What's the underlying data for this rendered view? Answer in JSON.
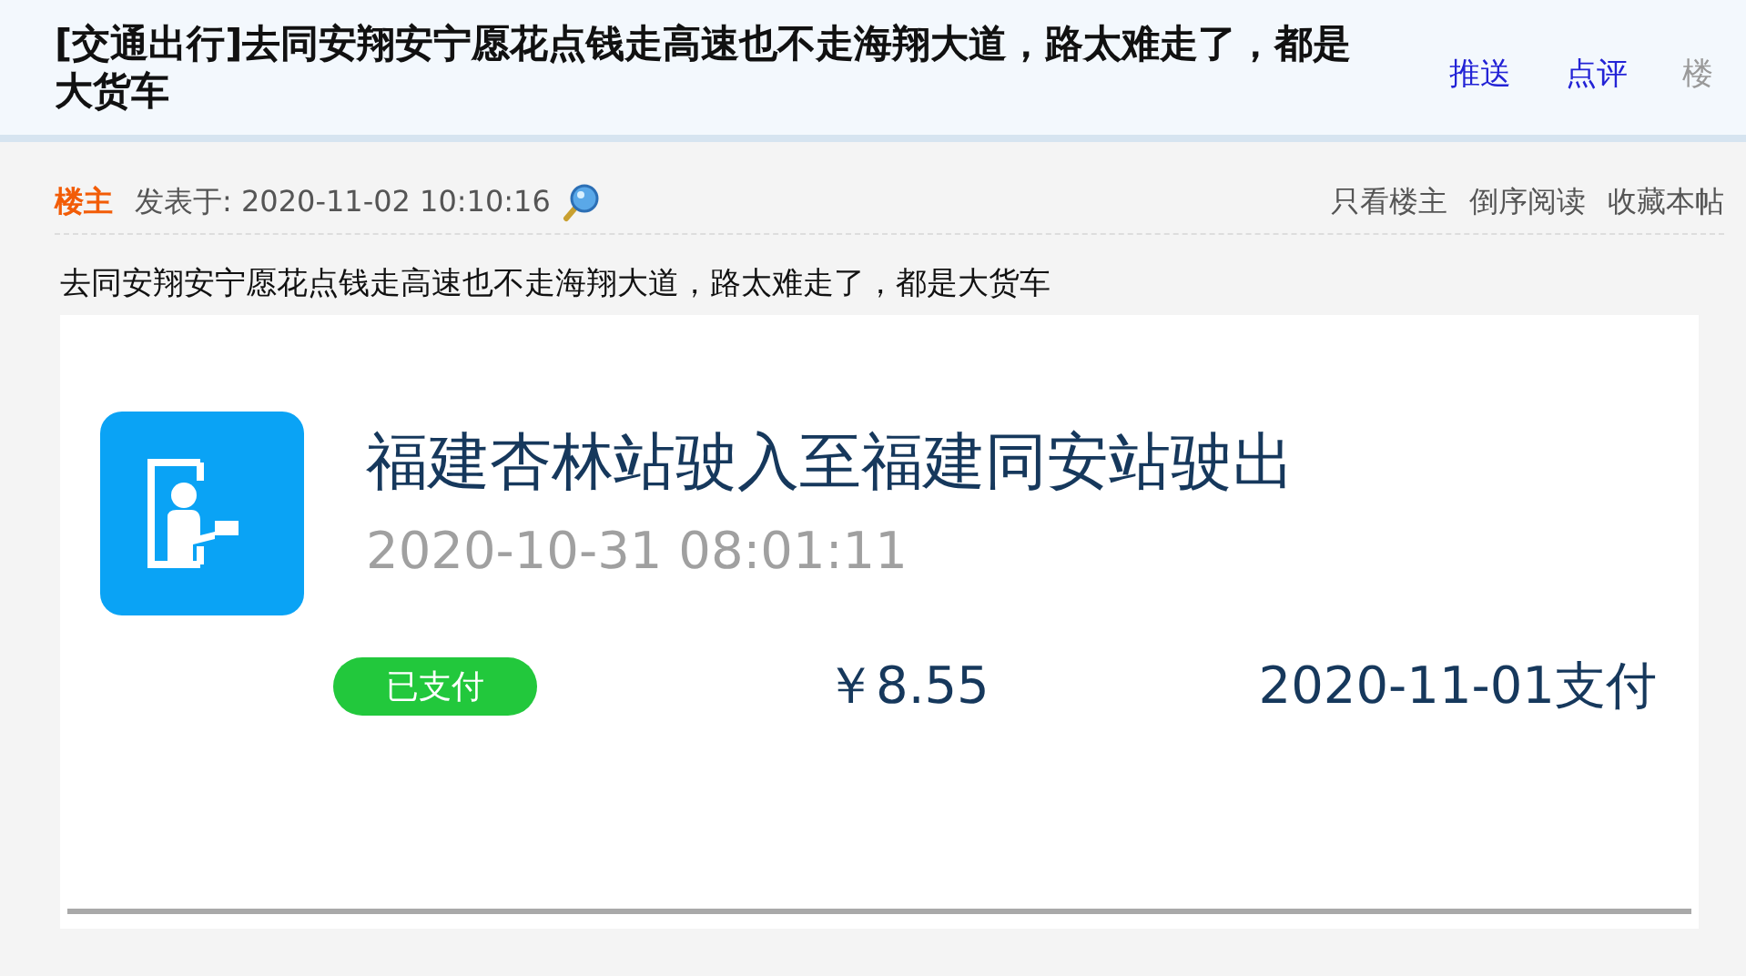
{
  "thread": {
    "title": "[交通出行]去同安翔安宁愿花点钱走高速也不走海翔大道，路太难走了，都是大货车",
    "actions": [
      {
        "label": "推送",
        "kind": "link"
      },
      {
        "label": "点评",
        "kind": "link"
      },
      {
        "label": "楼",
        "kind": "muted"
      }
    ]
  },
  "post": {
    "author_badge": "楼主",
    "posted": "发表于: 2020-11-02 10:10:16",
    "tools": [
      "只看楼主",
      "倒序阅读",
      "收藏本帖"
    ],
    "body": "去同安翔安宁愿花点钱走高速也不走海翔大道，路太难走了，都是大货车",
    "screenshot": {
      "route": "福建杏林站驶入至福建同安站驶出",
      "time": "2020-10-31 08:01:11",
      "status": "已支付",
      "paid": true,
      "amount": "￥8.55",
      "paid_date": "2020-11-01支付"
    }
  }
}
